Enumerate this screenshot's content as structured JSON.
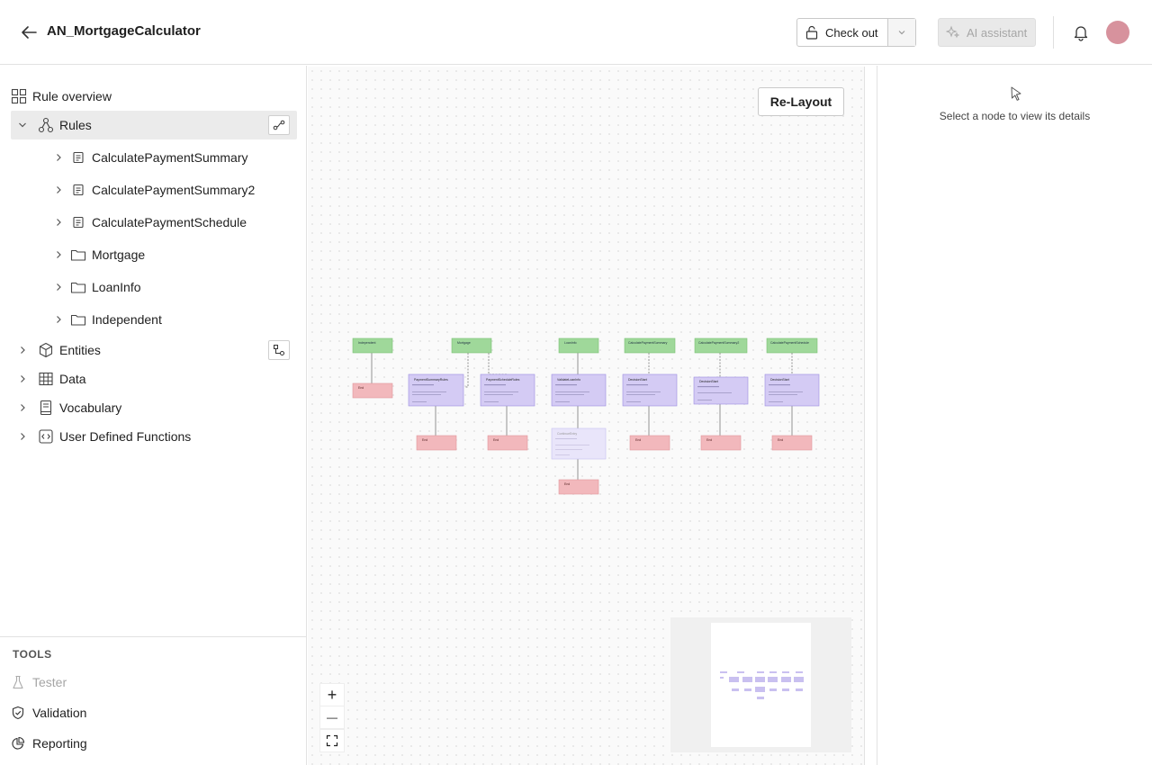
{
  "header": {
    "title": "AN_MortgageCalculator",
    "checkout_label": "Check out",
    "ai_label": "AI assistant",
    "avatar_color": "#d7929d"
  },
  "sidebar": {
    "rule_overview": "Rule overview",
    "rules": "Rules",
    "rule_items": [
      {
        "label": "CalculatePaymentSummary",
        "icon": "document-icon"
      },
      {
        "label": "CalculatePaymentSummary2",
        "icon": "document-icon"
      },
      {
        "label": "CalculatePaymentSchedule",
        "icon": "document-icon"
      },
      {
        "label": "Mortgage",
        "icon": "folder-icon"
      },
      {
        "label": "LoanInfo",
        "icon": "folder-icon"
      },
      {
        "label": "Independent",
        "icon": "folder-icon"
      }
    ],
    "entities": "Entities",
    "data": "Data",
    "vocabulary": "Vocabulary",
    "udf": "User Defined Functions"
  },
  "tools": {
    "title": "TOOLS",
    "tester": "Tester",
    "validation": "Validation",
    "reporting": "Reporting"
  },
  "canvas": {
    "relayout_label": "Re-Layout",
    "zoom_in": "+",
    "zoom_out": "—",
    "colors": {
      "start": "#9fd89a",
      "decision": "#d4cbf4",
      "decision_border": "#9b8ee0",
      "end": "#f2b8bc"
    },
    "nodes": {
      "starts": [
        "Independent",
        "Mortgage",
        "LoanInfo",
        "CalculatePaymentSummary",
        "CalculatePaymentSummary2",
        "CalculatePaymentSchedule"
      ],
      "decisions": [
        "PaymentSummaryRules",
        "PaymentScheduleRules",
        "ValidateLoanInfo",
        "DecisionStart",
        "DecisionStart",
        "DecisionStart"
      ],
      "secondary": "ContinueEntry",
      "end": "End"
    }
  },
  "details": {
    "empty_message": "Select a node to view its details"
  }
}
